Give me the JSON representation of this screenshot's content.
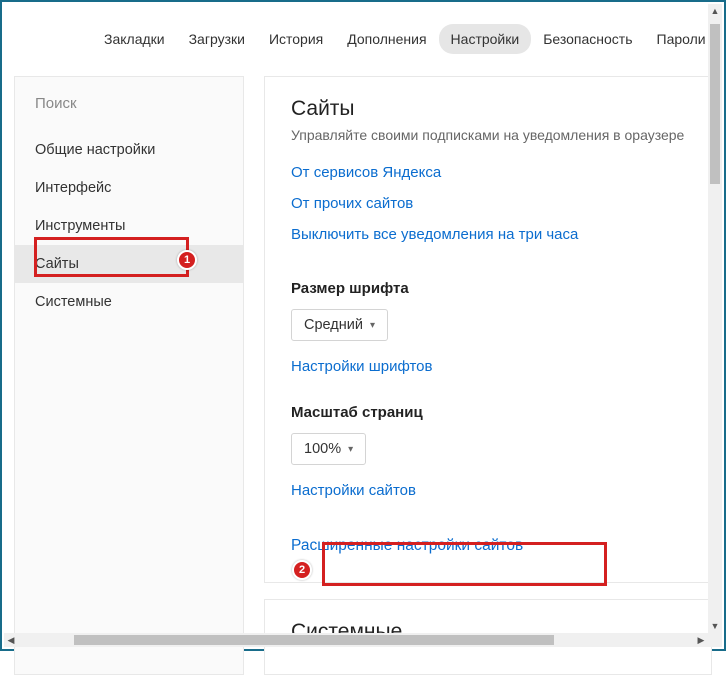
{
  "topTabs": [
    "Закладки",
    "Загрузки",
    "История",
    "Дополнения",
    "Настройки",
    "Безопасность",
    "Пароли и"
  ],
  "activeTopTab": 4,
  "search": {
    "placeholder": "Поиск"
  },
  "sidebar": {
    "items": [
      "Общие настройки",
      "Интерфейс",
      "Инструменты",
      "Сайты",
      "Системные"
    ],
    "activeIndex": 3
  },
  "main": {
    "title": "Сайты",
    "truncated": "Управляйте своими подписками на уведомления в ораузере",
    "links1": [
      "От сервисов Яндекса",
      "От прочих сайтов",
      "Выключить все уведомления на три часа"
    ],
    "fontSection": {
      "heading": "Размер шрифта",
      "selectValue": "Средний",
      "link": "Настройки шрифтов"
    },
    "scaleSection": {
      "heading": "Масштаб страниц",
      "selectValue": "100%",
      "link": "Настройки сайтов"
    },
    "advancedLink": "Расширенные настройки сайтов",
    "secondCardTitle": "Системные"
  },
  "badges": {
    "one": "1",
    "two": "2"
  }
}
